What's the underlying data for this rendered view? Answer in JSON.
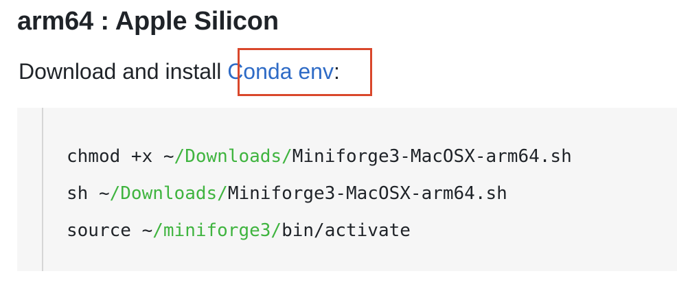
{
  "section": {
    "heading": "arm64 : Apple Silicon",
    "intro_prefix": "Download and install ",
    "link_text": "Conda env",
    "intro_suffix": ":"
  },
  "code": {
    "lines": [
      {
        "pre": "chmod +x ~",
        "path": "/Downloads/",
        "post": "Miniforge3-MacOSX-arm64.sh"
      },
      {
        "pre": "sh ~",
        "path": "/Downloads/",
        "post": "Miniforge3-MacOSX-arm64.sh"
      },
      {
        "pre": "source ~",
        "path": "/miniforge3/",
        "post": "bin/activate"
      }
    ]
  },
  "colors": {
    "link": "#2e6bc6",
    "highlight_box": "#d9472b",
    "path": "#3fb43f",
    "code_background": "#f6f6f6"
  }
}
